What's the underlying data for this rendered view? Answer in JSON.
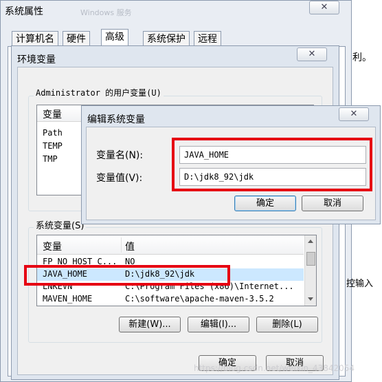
{
  "system_props": {
    "title": "系统属性",
    "faded_title": "Windows 服务",
    "close": "✕"
  },
  "tabs": [
    "计算机名",
    "硬件",
    "高级",
    "系统保护",
    "远程"
  ],
  "bg_fragments": {
    "right_text_1": "利。",
    "right_text_2": "控输入"
  },
  "env_vars": {
    "title": "环境变量",
    "close": "✕",
    "user_group_label": "Administrator 的用户变量(U)",
    "user_header": "变量",
    "user_rows": [
      "Path",
      "TEMP",
      "TMP"
    ],
    "system_group_label": "系统变量(S)",
    "columns": {
      "var": "变量",
      "value": "值"
    },
    "system_rows": [
      {
        "name": "FP_NO_HOST_C...",
        "value": "NO"
      },
      {
        "name": "JAVA_HOME",
        "value": "D:\\jdk8_92\\jdk"
      },
      {
        "name": "LNKEVN",
        "value": "C:\\Program Files (x86)\\Internet..."
      },
      {
        "name": "MAVEN_HOME",
        "value": "C:\\software\\apache-maven-3.5.2"
      }
    ],
    "buttons": {
      "new": "新建(W)...",
      "edit": "编辑(I)...",
      "delete": "删除(L)"
    },
    "ok": "确定",
    "cancel": "取消"
  },
  "edit_dialog": {
    "title": "编辑系统变量",
    "close": "✕",
    "name_label": "变量名(N):",
    "name_value": "JAVA_HOME",
    "value_label": "变量值(V):",
    "value_value": "D:\\jdk8_92\\jdk",
    "ok": "确定",
    "cancel": "取消"
  },
  "watermark": "https://blog.csdn.net/weixin_43842054",
  "colors": {
    "highlight_box": "#e60012",
    "selection": "#cce8ff"
  }
}
